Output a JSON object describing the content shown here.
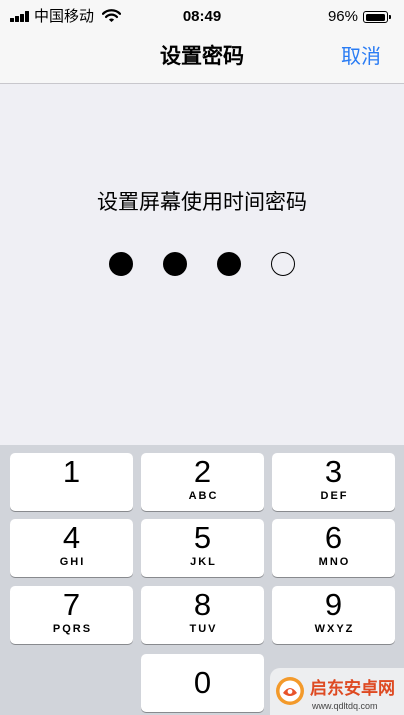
{
  "status_bar": {
    "carrier": "中国移动",
    "time": "08:49",
    "battery_text": "96%",
    "battery_level": 0.96,
    "icons": {
      "signal": "signal-bars-icon",
      "wifi": "wifi-icon",
      "battery": "battery-icon"
    }
  },
  "nav": {
    "title": "设置密码",
    "cancel_label": "取消"
  },
  "passcode": {
    "prompt": "设置屏幕使用时间密码",
    "length": 4,
    "entered": 3
  },
  "keypad": {
    "keys": [
      {
        "digit": "1"
      },
      {
        "digit": "2",
        "letters": "ABC"
      },
      {
        "digit": "3",
        "letters": "DEF"
      },
      {
        "digit": "4",
        "letters": "GHI"
      },
      {
        "digit": "5",
        "letters": "JKL"
      },
      {
        "digit": "6",
        "letters": "MNO"
      },
      {
        "digit": "7",
        "letters": "PQRS"
      },
      {
        "digit": "8",
        "letters": "TUV"
      },
      {
        "digit": "9",
        "letters": "WXYZ"
      },
      {
        "digit": "0"
      }
    ]
  },
  "watermark": {
    "name": "启东安卓网",
    "url": "www.qdltdq.com",
    "icon": "site-logo-icon"
  },
  "colors": {
    "accent": "#2a7cf4",
    "keypad_background": "#d1d4da",
    "page_background": "#efeff4",
    "bar_background": "#f7f7f7",
    "watermark_text": "#de4a22"
  }
}
